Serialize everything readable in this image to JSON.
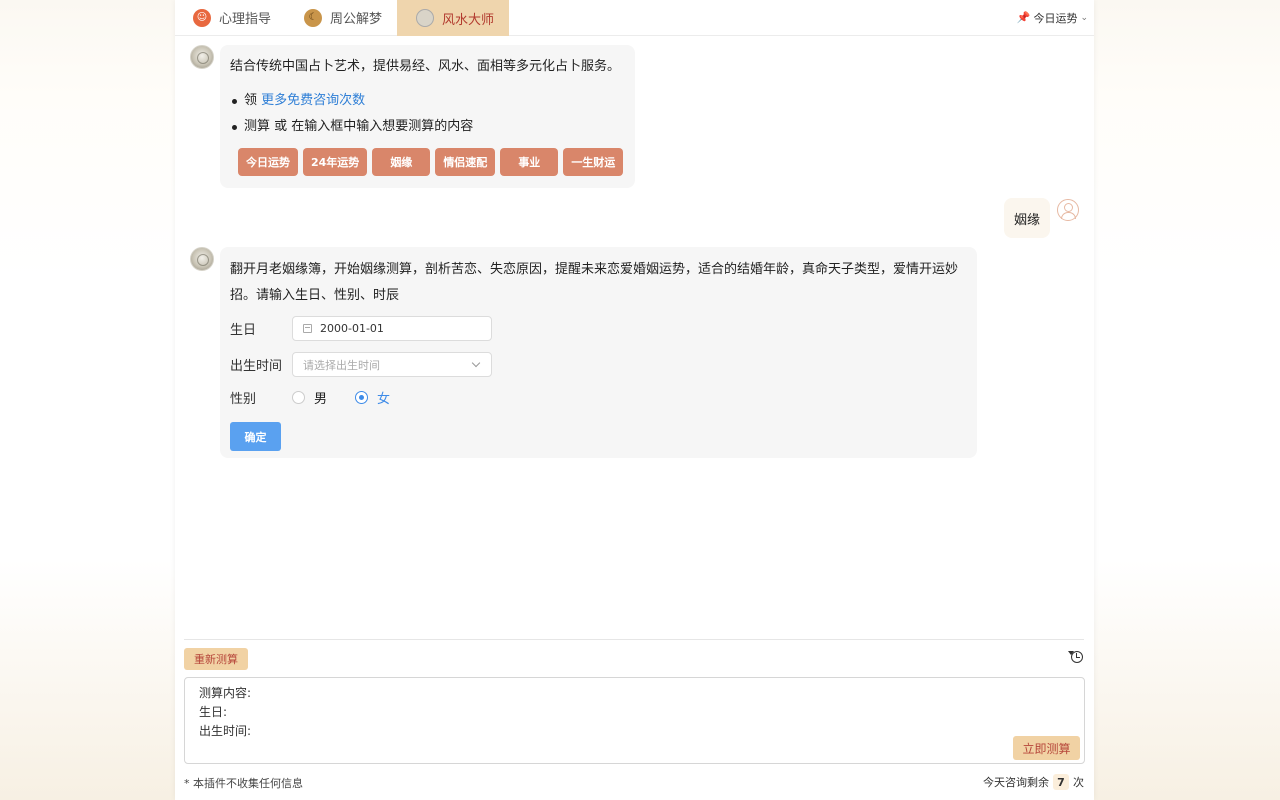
{
  "tabs": [
    {
      "label": "心理指导",
      "icon": "smile-icon"
    },
    {
      "label": "周公解梦",
      "icon": "moon-icon"
    },
    {
      "label": "风水大师",
      "icon": "compass-icon",
      "active": true
    }
  ],
  "top_right": {
    "label": "今日运势",
    "icon": "pin-icon"
  },
  "messages": {
    "intro": {
      "text": "结合传统中国占卜艺术，提供易经、风水、面相等多元化占卜服务。",
      "bullet1_prefix": "领",
      "bullet1_link": "更多免费咨询次数",
      "bullet2": "测算 或 在输入框中输入想要测算的内容",
      "chips": [
        "今日运势",
        "24年运势",
        "姻缘",
        "情侣速配",
        "事业",
        "一生财运"
      ]
    },
    "user": {
      "text": "姻缘"
    },
    "reply": {
      "line1": "翻开月老姻缘簿，开始姻缘测算，剖析苦恋、失恋原因，提醒未来恋爱婚姻运势，适合的结婚年龄，真命天子类型，爱情开运妙",
      "line2": "招。请输入生日、性别、时辰",
      "form": {
        "birthday_label": "生日",
        "birthday_value": "2000-01-01",
        "birthtime_label": "出生时间",
        "birthtime_placeholder": "请选择出生时间",
        "gender_label": "性别",
        "gender_male": "男",
        "gender_female": "女",
        "gender_selected": "女",
        "confirm_label": "确定"
      }
    }
  },
  "bottom": {
    "reset_label": "重新测算",
    "input_lines": [
      "测算内容:",
      "生日:",
      "出生时间:"
    ],
    "submit_label": "立即测算",
    "footer_note": "* 本插件不收集任何信息",
    "remain_prefix": "今天咨询剩余",
    "remain_count": "7",
    "remain_suffix": "次"
  },
  "colors": {
    "accent_chip": "#d9866a",
    "active_tab_bg": "#efd5ad",
    "active_tab_text": "#b23a2e",
    "primary_button": "#5aa1f0",
    "link": "#2f7fd6"
  }
}
